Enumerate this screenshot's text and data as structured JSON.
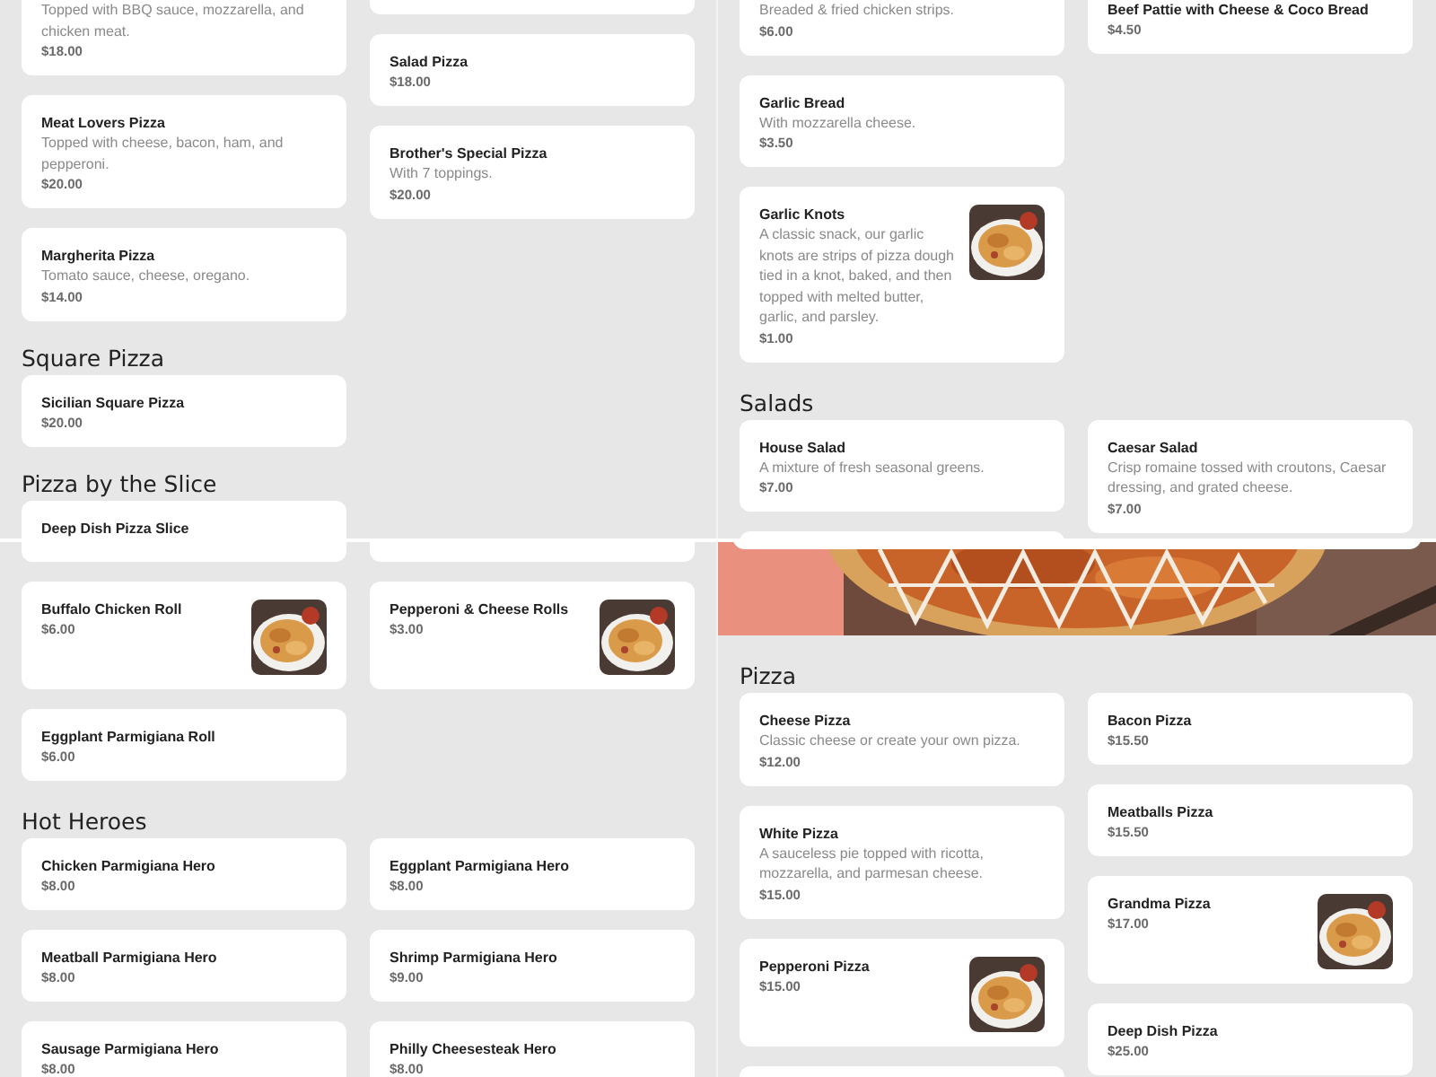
{
  "panels": [
    {
      "sections": [
        {
          "columns": [
            {
              "items": [
                {
                  "kind": "plain",
                  "description": "Topped with BBQ sauce, mozzarella, and chicken meat.",
                  "price": "$18.00"
                },
                {
                  "kind": "plain",
                  "name": "Meat Lovers Pizza",
                  "description": "Topped with cheese, bacon, ham, and pepperoni.",
                  "price": "$20.00"
                },
                {
                  "kind": "plain",
                  "name": "Margherita Pizza",
                  "description": "Tomato sauce, cheese, oregano.",
                  "price": "$14.00"
                }
              ]
            },
            {
              "items": [
                {
                  "kind": "blank"
                },
                {
                  "kind": "plain",
                  "name": "Salad Pizza",
                  "price": "$18.00"
                },
                {
                  "kind": "plain",
                  "name": "Brother's Special Pizza",
                  "description": "With 7 toppings.",
                  "price": "$20.00"
                }
              ]
            }
          ]
        },
        {
          "heading": "Square Pizza",
          "columns": [
            {
              "items": [
                {
                  "kind": "plain",
                  "name": "Sicilian Square Pizza",
                  "price": "$20.00"
                }
              ]
            }
          ]
        },
        {
          "heading": "Pizza by the Slice",
          "columns": [
            {
              "items": [
                {
                  "kind": "plain",
                  "name": "Deep Dish Pizza Slice"
                }
              ]
            }
          ]
        }
      ]
    },
    {
      "sections": [
        {
          "columns": [
            {
              "items": [
                {
                  "kind": "plain",
                  "description": "Breaded & fried chicken strips.",
                  "price": "$6.00"
                },
                {
                  "kind": "plain",
                  "name": "Garlic Bread",
                  "description": "With mozzarella cheese.",
                  "price": "$3.50"
                },
                {
                  "name": "Garlic Knots",
                  "description": "A classic snack, our garlic knots are strips of pizza dough tied in a knot, baked, and then topped with melted butter, garlic, and parsley.",
                  "price": "$1.00"
                }
              ]
            },
            {
              "items": [
                {
                  "kind": "plain",
                  "name": "Beef Pattie with Cheese & Coco Bread",
                  "price": "$4.50"
                }
              ]
            }
          ]
        },
        {
          "heading": "Salads",
          "columns": [
            {
              "items": [
                {
                  "kind": "plain",
                  "name": "House Salad",
                  "description": "A mixture of fresh seasonal greens.",
                  "price": "$7.00"
                },
                {
                  "kind": "blank"
                }
              ]
            },
            {
              "items": [
                {
                  "kind": "plain",
                  "name": "Caesar Salad",
                  "description": "Crisp romaine tossed with croutons, Caesar dressing, and grated cheese.",
                  "price": "$7.00"
                }
              ]
            }
          ]
        }
      ]
    },
    {
      "sections": [
        {
          "columns": [
            {
              "items": [
                {
                  "kind": "blank"
                },
                {
                  "name": "Buffalo Chicken Roll",
                  "price": "$6.00"
                },
                {
                  "kind": "plain",
                  "name": "Eggplant Parmigiana Roll",
                  "price": "$6.00"
                }
              ]
            },
            {
              "items": [
                {
                  "kind": "blank"
                },
                {
                  "name": "Pepperoni & Cheese Rolls",
                  "price": "$3.00"
                }
              ]
            }
          ]
        },
        {
          "heading": "Hot Heroes",
          "columns": [
            {
              "items": [
                {
                  "kind": "plain",
                  "name": "Chicken Parmigiana Hero",
                  "price": "$8.00"
                },
                {
                  "kind": "plain",
                  "name": "Meatball Parmigiana Hero",
                  "price": "$8.00"
                },
                {
                  "kind": "plain",
                  "name": "Sausage Parmigiana Hero",
                  "price": "$8.00"
                }
              ]
            },
            {
              "items": [
                {
                  "kind": "plain",
                  "name": "Eggplant Parmigiana Hero",
                  "price": "$8.00"
                },
                {
                  "kind": "plain",
                  "name": "Shrimp Parmigiana Hero",
                  "price": "$9.00"
                },
                {
                  "kind": "plain",
                  "name": "Philly Cheesesteak Hero",
                  "price": "$8.00"
                }
              ]
            }
          ]
        }
      ]
    },
    {
      "hero": {
        "kind": "picture"
      },
      "sections": [
        {
          "heading": "Pizza",
          "columns": [
            {
              "items": [
                {
                  "kind": "plain",
                  "name": "Cheese Pizza",
                  "description": "Classic cheese or create your own pizza.",
                  "price": "$12.00"
                },
                {
                  "kind": "plain",
                  "name": "White Pizza",
                  "description": "A sauceless pie topped with ricotta, mozzarella, and parmesan cheese.",
                  "price": "$15.00"
                },
                {
                  "name": "Pepperoni Pizza",
                  "price": "$15.00"
                },
                {
                  "kind": "blank"
                }
              ]
            },
            {
              "items": [
                {
                  "kind": "plain",
                  "name": "Bacon Pizza",
                  "price": "$15.50"
                },
                {
                  "kind": "plain",
                  "name": "Meatballs Pizza",
                  "price": "$15.50"
                },
                {
                  "name": "Grandma Pizza",
                  "price": "$17.00"
                },
                {
                  "kind": "plain",
                  "name": "Deep Dish Pizza",
                  "price": "$25.00"
                }
              ]
            }
          ]
        }
      ]
    }
  ]
}
